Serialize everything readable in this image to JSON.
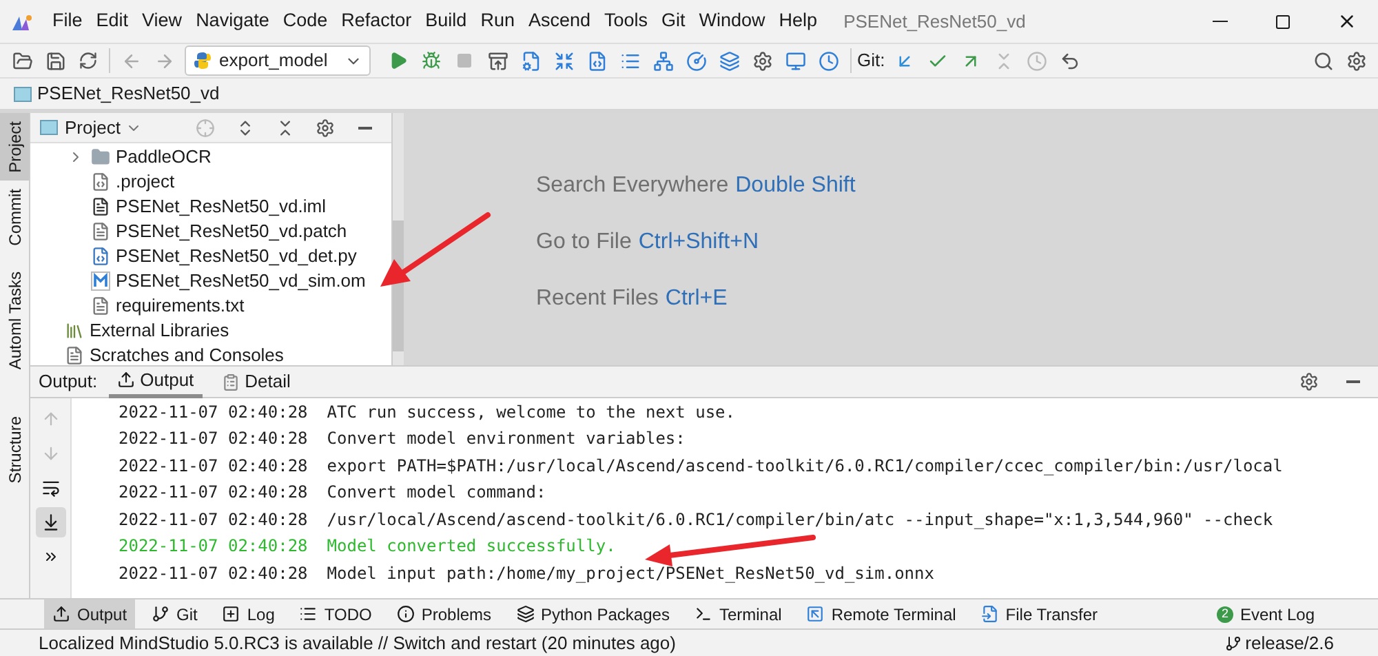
{
  "window": {
    "title": "PSENet_ResNet50_vd"
  },
  "menu": [
    "File",
    "Edit",
    "View",
    "Navigate",
    "Code",
    "Refactor",
    "Build",
    "Run",
    "Ascend",
    "Tools",
    "Git",
    "Window",
    "Help"
  ],
  "toolbar": {
    "run_config": "export_model",
    "git_label": "Git:"
  },
  "breadcrumb": "PSENet_ResNet50_vd",
  "side_tabs": [
    {
      "label": "Project",
      "selected": true
    },
    {
      "label": "Commit",
      "selected": false
    },
    {
      "label": "Automl Tasks",
      "selected": false
    },
    {
      "label": "Structure",
      "selected": false
    }
  ],
  "project_panel": {
    "title": "Project",
    "project_children": [
      {
        "label": "PaddleOCR",
        "kind": "folder",
        "expanded": false
      },
      {
        "label": ".project",
        "kind": "config"
      },
      {
        "label": "PSENet_ResNet50_vd.iml",
        "kind": "module"
      },
      {
        "label": "PSENet_ResNet50_vd.patch",
        "kind": "patch"
      },
      {
        "label": "PSENet_ResNet50_vd_det.py",
        "kind": "python"
      },
      {
        "label": "PSENet_ResNet50_vd_sim.om",
        "kind": "model"
      },
      {
        "label": "requirements.txt",
        "kind": "text"
      }
    ],
    "roots": [
      {
        "label": "External Libraries",
        "kind": "libraries"
      },
      {
        "label": "Scratches and Consoles",
        "kind": "scratches"
      }
    ]
  },
  "editor_hints": [
    {
      "action": "Search Everywhere",
      "shortcut": "Double Shift"
    },
    {
      "action": "Go to File",
      "shortcut": "Ctrl+Shift+N"
    },
    {
      "action": "Recent Files",
      "shortcut": "Ctrl+E"
    }
  ],
  "output": {
    "label": "Output:",
    "tabs": [
      {
        "label": "Output",
        "selected": true
      },
      {
        "label": "Detail",
        "selected": false
      }
    ],
    "lines": [
      {
        "time": "2022-11-07 02:40:28",
        "message": "ATC run success, welcome to the next use.",
        "kind": "info"
      },
      {
        "time": "2022-11-07 02:40:28",
        "message": "Convert model environment variables:",
        "kind": "info"
      },
      {
        "time": "2022-11-07 02:40:28",
        "message": "export PATH=$PATH:/usr/local/Ascend/ascend-toolkit/6.0.RC1/compiler/ccec_compiler/bin:/usr/local",
        "kind": "info"
      },
      {
        "time": "2022-11-07 02:40:28",
        "message": "Convert model command:",
        "kind": "info"
      },
      {
        "time": "2022-11-07 02:40:28",
        "message": "/usr/local/Ascend/ascend-toolkit/6.0.RC1/compiler/bin/atc  --input_shape=\"x:1,3,544,960\" --check",
        "kind": "info"
      },
      {
        "time": "2022-11-07 02:40:28",
        "message": "Model converted successfully.",
        "kind": "success"
      },
      {
        "time": "2022-11-07 02:40:28",
        "message": "Model input path:/home/my_project/PSENet_ResNet50_vd_sim.onnx",
        "kind": "info"
      }
    ]
  },
  "bottom_tabs": [
    {
      "label": "Output",
      "kind": "output",
      "selected": true
    },
    {
      "label": "Git",
      "kind": "git",
      "selected": false
    },
    {
      "label": "Log",
      "kind": "log",
      "selected": false
    },
    {
      "label": "TODO",
      "kind": "todo",
      "selected": false
    },
    {
      "label": "Problems",
      "kind": "problems",
      "selected": false
    },
    {
      "label": "Python Packages",
      "kind": "packages",
      "selected": false
    },
    {
      "label": "Terminal",
      "kind": "terminal",
      "selected": false
    },
    {
      "label": "Remote Terminal",
      "kind": "remote",
      "selected": false
    },
    {
      "label": "File Transfer",
      "kind": "transfer",
      "selected": false
    },
    {
      "label": "Event Log",
      "kind": "events",
      "selected": false,
      "badge": "2"
    }
  ],
  "status_bar": {
    "message": "Localized MindStudio 5.0.RC3 is available // Switch and restart (20 minutes ago)",
    "branch": "release/2.6"
  }
}
